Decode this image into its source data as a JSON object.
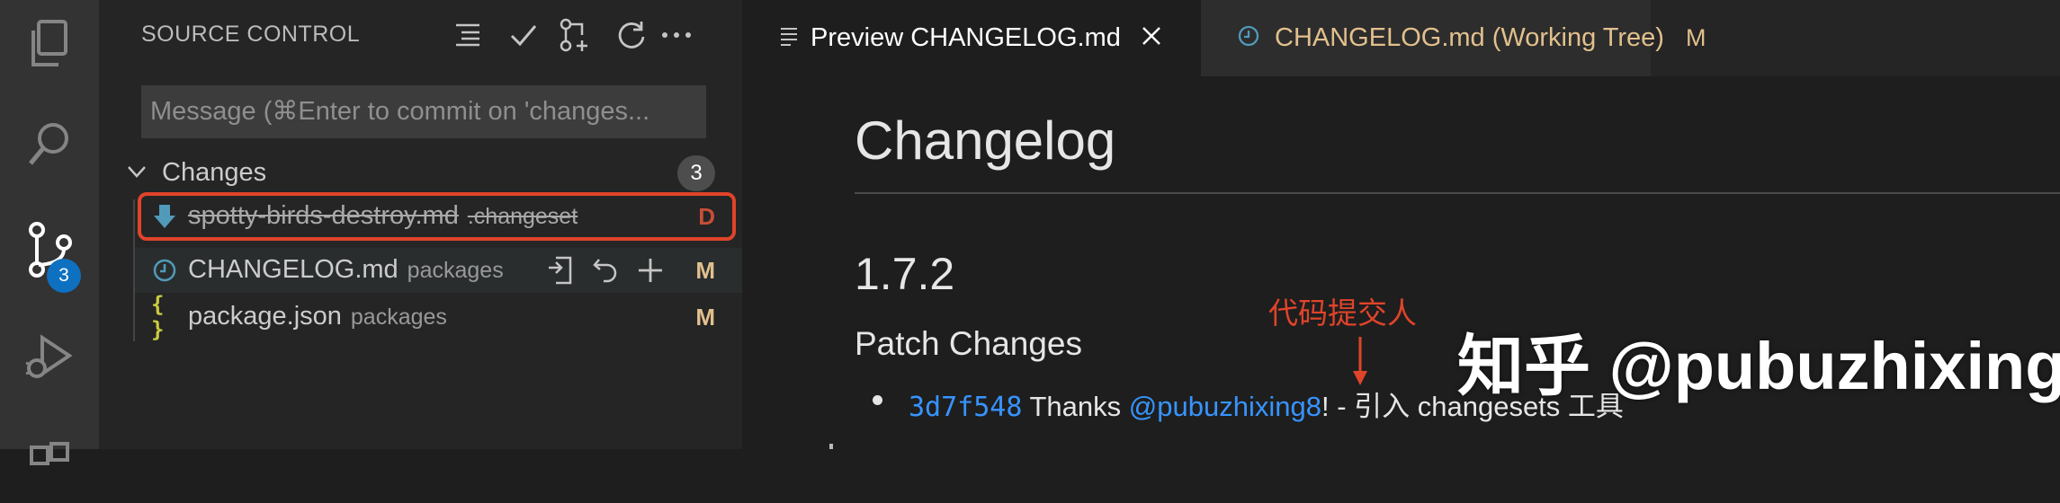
{
  "activity_bar": {
    "source_control_badge": "3",
    "icons": [
      "explorer-icon",
      "search-icon",
      "source-control-icon",
      "run-debug-icon",
      "extensions-icon"
    ]
  },
  "sidebar": {
    "title": "SOURCE CONTROL",
    "toolbar_icons": [
      "view-as-tree-icon",
      "commit-icon",
      "create-pull-request-icon",
      "refresh-icon",
      "more-actions-icon"
    ],
    "commit_message_placeholder": "Message (⌘Enter to commit on 'changes...",
    "changes": {
      "label": "Changes",
      "count": "3",
      "files": [
        {
          "name": "spotty-birds-destroy.md",
          "path": ".changeset",
          "status": "D",
          "deleted": true
        },
        {
          "name": "CHANGELOG.md",
          "path": "packages",
          "status": "M",
          "deleted": false
        },
        {
          "name": "package.json",
          "path": "packages",
          "status": "M",
          "deleted": false
        }
      ]
    }
  },
  "editor": {
    "tabs": [
      {
        "label": "Preview CHANGELOG.md",
        "active": true
      },
      {
        "label": "CHANGELOG.md (Working Tree)",
        "status": "M",
        "active": false
      }
    ],
    "preview": {
      "h1": "Changelog",
      "version": "1.7.2",
      "section": "Patch Changes",
      "item": {
        "hash": "3d7f548",
        "thanks": "Thanks",
        "user": "@pubuzhixing8",
        "rest": "! - 引入 changesets 工具"
      }
    }
  },
  "annotation": {
    "label": "代码提交人",
    "color": "#e0442a"
  },
  "watermark": "知乎 @pubuzhixing",
  "colors": {
    "badge_blue": "#0e70c0",
    "deleted_red": "#c74e39",
    "modified_gold": "#e2c08d",
    "link_blue": "#3794ff",
    "highlight_red": "#e0442a"
  }
}
